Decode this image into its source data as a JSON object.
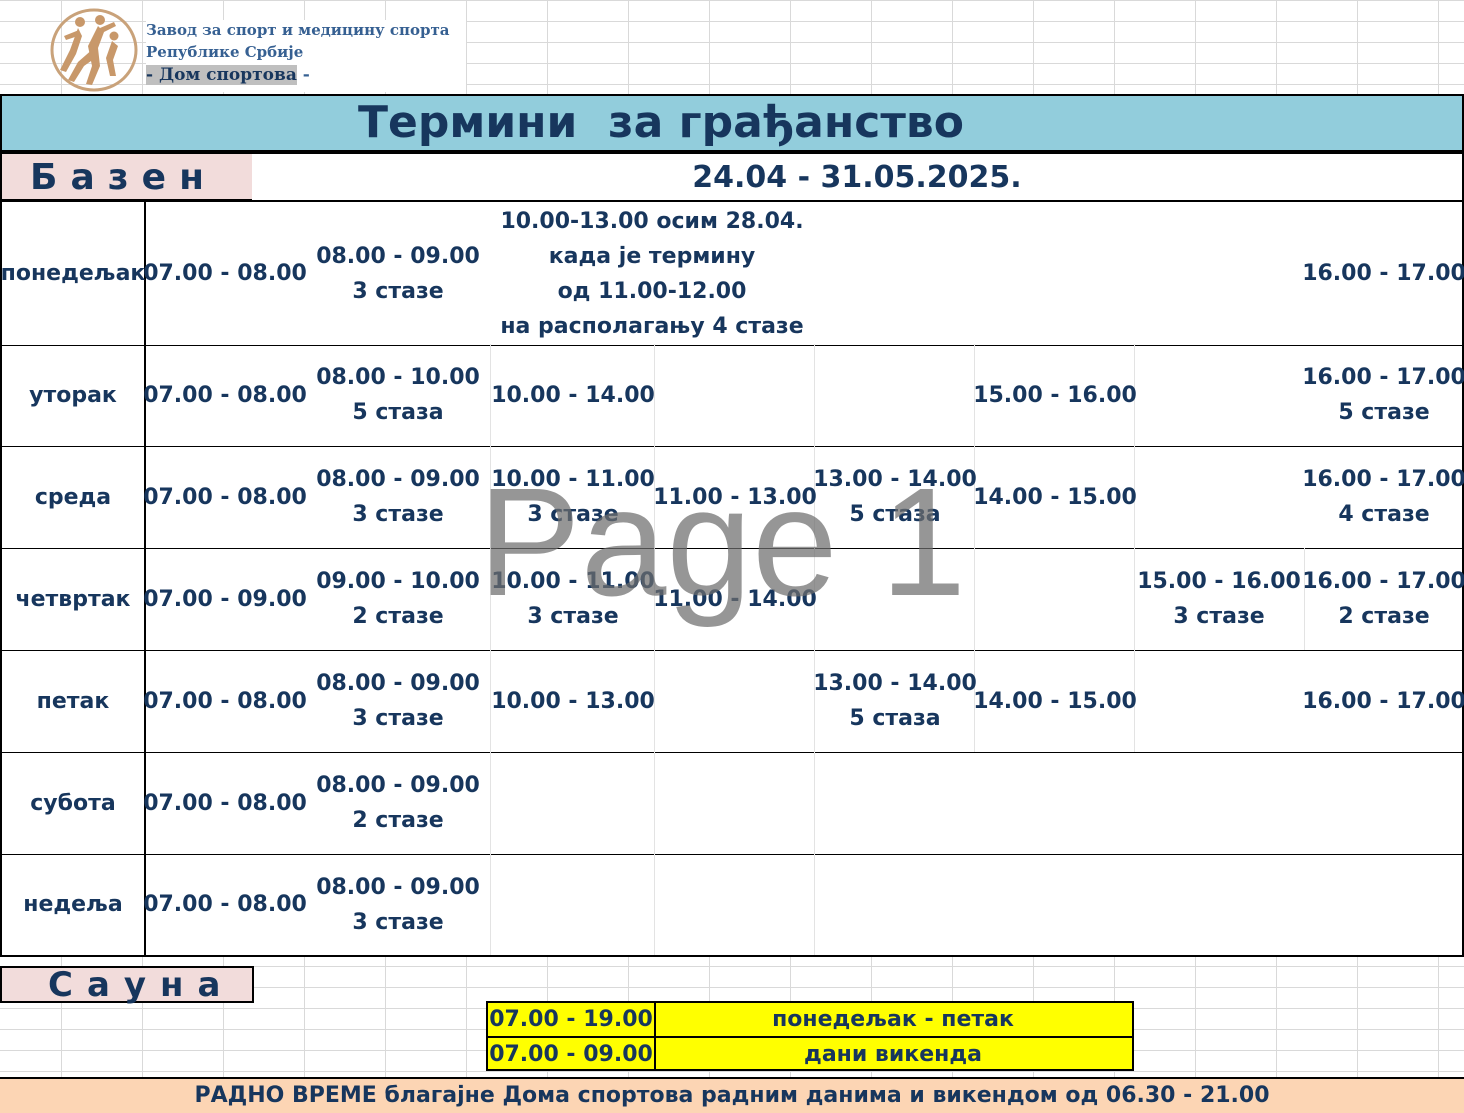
{
  "header": {
    "org_line1": "Завод за спорт и медицину спорта",
    "org_line2": "Републике Србије",
    "org_line3_dash1": "- ",
    "org_line3_name": "Дом спортова",
    "org_line3_dash2": " -",
    "logo_icon": "sport-figures-logo",
    "title": "Термини  за грађанство"
  },
  "pool": {
    "label": "Базен",
    "date_range": "24.04 - 31.05.2025."
  },
  "schedule": {
    "rows": [
      {
        "day": "понедељак",
        "slots": [
          {
            "lines": [
              "07.00 - 08.00"
            ]
          },
          {
            "lines": [
              "08.00 - 09.00",
              "3 стазе"
            ]
          },
          {
            "lines": [
              "10.00-13.00 осим 28.04.",
              "када је термину",
              "од 11.00-12.00",
              "на располагању 4 стазе"
            ]
          },
          {
            "lines": [
              "16.00 - 17.00"
            ]
          }
        ]
      },
      {
        "day": "уторак",
        "slots": [
          {
            "lines": [
              "07.00 - 08.00"
            ]
          },
          {
            "lines": [
              "08.00 - 10.00",
              "5 стаза"
            ]
          },
          {
            "lines": [
              "10.00 - 14.00"
            ]
          },
          {
            "lines": [
              "15.00 - 16.00"
            ]
          },
          {
            "lines": [
              "16.00 - 17.00",
              "5 стазе"
            ]
          }
        ]
      },
      {
        "day": "среда",
        "slots": [
          {
            "lines": [
              "07.00 - 08.00"
            ]
          },
          {
            "lines": [
              "08.00 - 09.00",
              "3 стазе"
            ]
          },
          {
            "lines": [
              "10.00 - 11.00",
              "3 стазе"
            ]
          },
          {
            "lines": [
              "11.00 - 13.00"
            ]
          },
          {
            "lines": [
              "13.00 - 14.00",
              "5 стаза"
            ]
          },
          {
            "lines": [
              "14.00 - 15.00"
            ]
          },
          {
            "lines": [
              "16.00 - 17.00",
              "4 стазе"
            ]
          }
        ]
      },
      {
        "day": "четвртак",
        "slots": [
          {
            "lines": [
              "07.00 - 09.00"
            ]
          },
          {
            "lines": [
              "09.00 - 10.00",
              "2 стазе"
            ]
          },
          {
            "lines": [
              "10.00 - 11.00",
              "3 стазе"
            ]
          },
          {
            "lines": [
              "11.00 - 14.00"
            ]
          },
          {
            "lines": [
              "15.00 - 16.00",
              "3 стазе"
            ]
          },
          {
            "lines": [
              "16.00 - 17.00",
              "2 стазе"
            ]
          }
        ]
      },
      {
        "day": "петак",
        "slots": [
          {
            "lines": [
              "07.00 - 08.00"
            ]
          },
          {
            "lines": [
              "08.00 - 09.00",
              "3 стазе"
            ]
          },
          {
            "lines": [
              "10.00 - 13.00"
            ]
          },
          {
            "lines": [
              "13.00 - 14.00",
              "5 стаза"
            ]
          },
          {
            "lines": [
              "14.00 - 15.00"
            ]
          },
          {
            "lines": [
              "16.00 - 17.00"
            ]
          }
        ]
      },
      {
        "day": "субота",
        "slots": [
          {
            "lines": [
              "07.00 - 08.00"
            ]
          },
          {
            "lines": [
              "08.00 - 09.00",
              "2 стазе"
            ]
          }
        ]
      },
      {
        "day": "недеља",
        "slots": [
          {
            "lines": [
              "07.00 - 08.00"
            ]
          },
          {
            "lines": [
              "08.00 - 09.00",
              "3 стазе"
            ]
          }
        ]
      }
    ]
  },
  "watermark": "Page 1",
  "sauna": {
    "label": "Сауна",
    "rows": [
      {
        "time": "07.00 - 19.00",
        "days": "понедељак - петак"
      },
      {
        "time": "07.00 - 09.00",
        "days": "дани викенда"
      }
    ]
  },
  "footer": {
    "text": "РАДНО ВРЕМЕ благајне Дома спортова радним данима и викендом од 06.30 - 21.00"
  },
  "colors": {
    "title_bar": "#92cddc",
    "label_bg": "#f2dcdb",
    "sauna_bg": "#ffff00",
    "footer_bg": "#fcd5b4",
    "text": "#17365d"
  }
}
